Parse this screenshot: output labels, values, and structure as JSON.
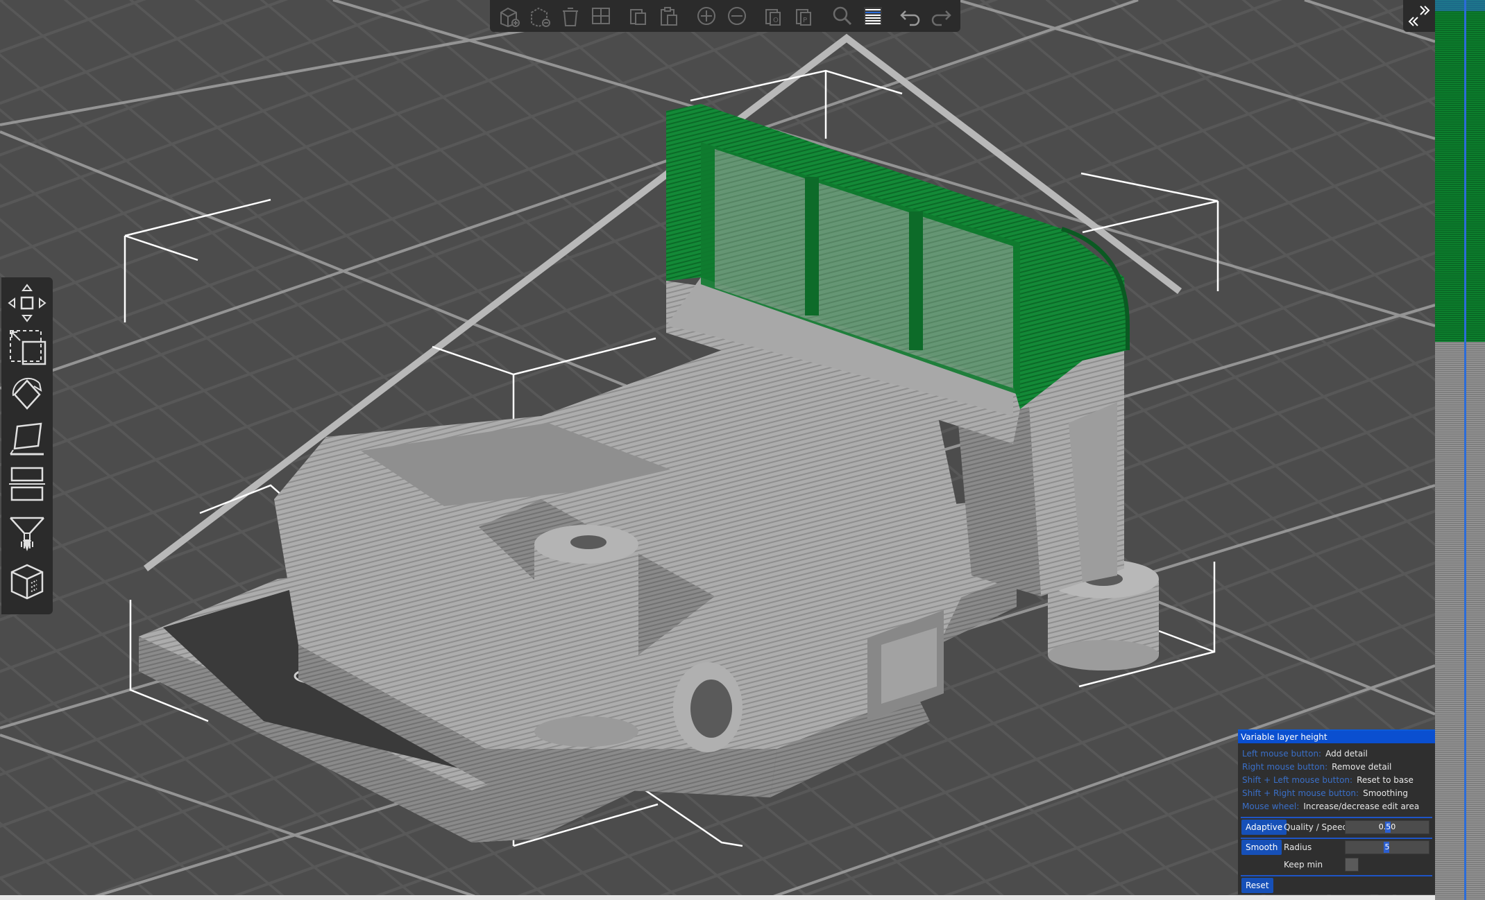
{
  "colors": {
    "accent": "#0a4fd0",
    "panel_bg": "#2f2f2f",
    "toolbar_bg": "#2b2b2b",
    "bed_bg": "#4a4a4a",
    "model_grey": "#a9a9a9",
    "adaptive_green": "#0f7a2f"
  },
  "top_toolbar": {
    "icons": [
      "add-icon",
      "delete-icon",
      "delete-all-icon",
      "arrange-icon",
      "copy-icon",
      "paste-icon",
      "add-instance-icon",
      "remove-instance-icon",
      "split-objects-icon",
      "split-parts-icon",
      "search-icon",
      "layers-editing-icon",
      "undo-icon",
      "redo-icon"
    ]
  },
  "left_toolbar": {
    "icons": [
      "move-icon",
      "scale-icon",
      "rotate-icon",
      "place-on-face-icon",
      "cut-icon",
      "paint-supports-icon",
      "seam-painting-icon"
    ]
  },
  "sidebar_collapse": {
    "icon": "collapse-sidebar-icon"
  },
  "vlh_panel": {
    "title": "Variable layer height",
    "hints": [
      {
        "key": "Left mouse button:",
        "value": "Add detail"
      },
      {
        "key": "Right mouse button:",
        "value": "Remove detail"
      },
      {
        "key": "Shift + Left mouse button:",
        "value": "Reset to base"
      },
      {
        "key": "Shift + Right mouse button:",
        "value": "Smoothing"
      },
      {
        "key": "Mouse wheel:",
        "value": "Increase/decrease edit area"
      }
    ],
    "adaptive_label": "Adaptive",
    "quality_label": "Quality / Speed",
    "quality_value": "0.50",
    "smooth_label": "Smooth",
    "radius_label": "Radius",
    "radius_value": "5",
    "keep_min_label": "Keep min",
    "keep_min_checked": false,
    "reset_label": "Reset"
  },
  "layer_slider": {
    "highlighted_fraction_from_top": 0.38
  }
}
